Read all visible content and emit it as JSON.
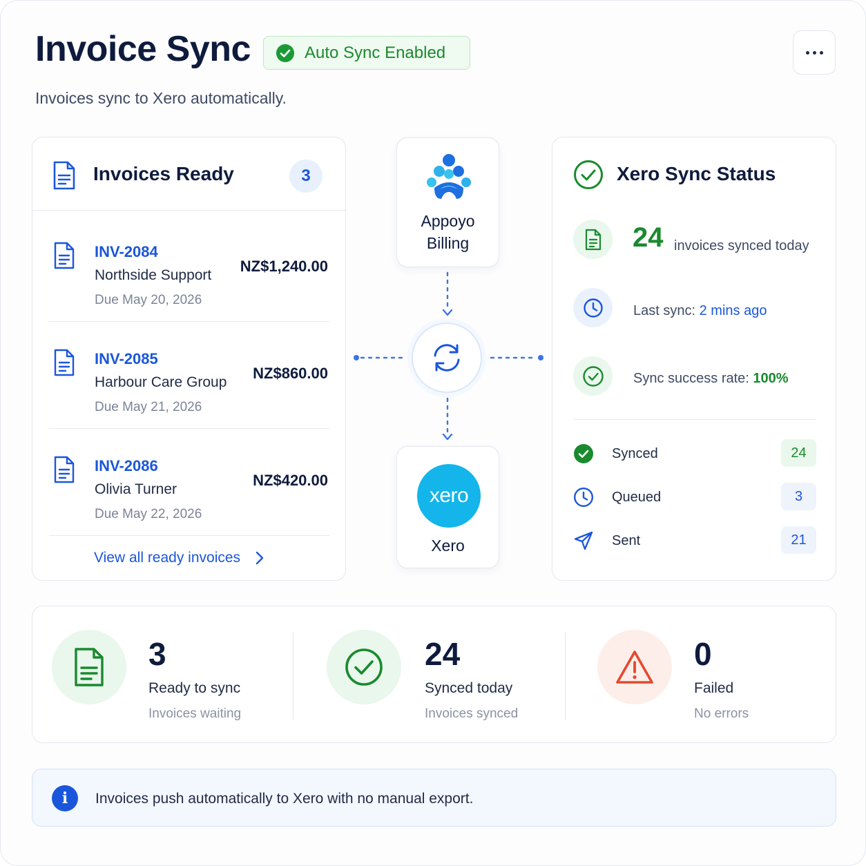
{
  "header": {
    "title": "Invoice Sync",
    "badge_label": "Auto Sync Enabled",
    "subtitle": "Invoices sync to Xero automatically."
  },
  "ready": {
    "title": "Invoices Ready",
    "count": "3",
    "invoices": [
      {
        "id": "INV-2084",
        "customer": "Northside Support",
        "due": "Due May 20, 2026",
        "amount": "NZ$1,240.00"
      },
      {
        "id": "INV-2085",
        "customer": "Harbour Care Group",
        "due": "Due May 21, 2026",
        "amount": "NZ$860.00"
      },
      {
        "id": "INV-2086",
        "customer": "Olivia Turner",
        "due": "Due May 22, 2026",
        "amount": "NZ$420.00"
      }
    ],
    "view_all": "View all ready invoices"
  },
  "flow": {
    "source_line1": "Appoyo",
    "source_line2": "Billing",
    "target_logo": "xero",
    "target_label": "Xero"
  },
  "status": {
    "title": "Xero Sync Status",
    "synced_today_value": "24",
    "synced_today_label": "invoices synced today",
    "last_sync_prefix": "Last sync:",
    "last_sync_value": "2 mins ago",
    "success_prefix": "Sync success rate:",
    "success_value": "100%",
    "legend": [
      {
        "label": "Synced",
        "value": "24",
        "icon": "check-circle-filled-icon"
      },
      {
        "label": "Queued",
        "value": "3",
        "icon": "clock-icon"
      },
      {
        "label": "Sent",
        "value": "21",
        "icon": "send-icon"
      }
    ]
  },
  "summary": [
    {
      "value": "3",
      "label": "Ready to sync",
      "sub": "Invoices waiting",
      "icon": "document-icon"
    },
    {
      "value": "24",
      "label": "Synced today",
      "sub": "Invoices synced",
      "icon": "check-circle-icon"
    },
    {
      "value": "0",
      "label": "Failed",
      "sub": "No errors",
      "icon": "warning-icon"
    }
  ],
  "info": {
    "text": "Invoices push automatically to Xero with no manual export."
  },
  "colors": {
    "brand_blue": "#1a56db",
    "success_green": "#1a8a2e",
    "error_red": "#e5482d",
    "xero_blue": "#13b5ea",
    "navy_text": "#0f1b3d"
  }
}
